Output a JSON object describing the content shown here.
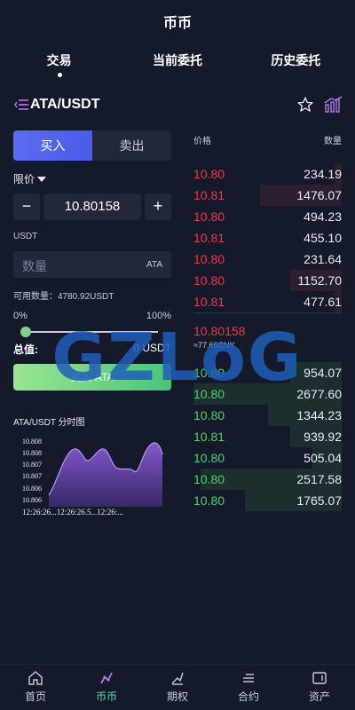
{
  "header": {
    "title": "币币"
  },
  "tabs": [
    {
      "label": "交易",
      "active": true
    },
    {
      "label": "当前委托",
      "active": false
    },
    {
      "label": "历史委托",
      "active": false
    }
  ],
  "pair": {
    "name": "ATA/USDT"
  },
  "trade": {
    "buy_label": "买入",
    "sell_label": "卖出",
    "order_type": "限价",
    "price": "10.80158",
    "minus": "−",
    "plus": "+",
    "unit_label": "USDT",
    "qty_placeholder": "数量",
    "qty_unit": "ATA",
    "available": "可用数量：4780.92USDT",
    "pct_min": "0%",
    "pct_max": "100%",
    "slider_value": 0,
    "total_label": "总值:",
    "total_value": "0 USDT",
    "submit_label": "买入 ATA"
  },
  "mini_chart": {
    "title": "ATA/USDT 分时图",
    "y_ticks": [
      "10.808",
      "10.808",
      "10.807",
      "10.807",
      "10.806",
      "10.806"
    ],
    "x_ticks": "12:26:26...12:26:26.5...12:26:..."
  },
  "orderbook": {
    "price_header": "价格",
    "qty_header": "数量",
    "asks": [
      {
        "price": "10.80",
        "qty": "234.19",
        "depth": 0.05
      },
      {
        "price": "10.81",
        "qty": "1476.07",
        "depth": 0.55
      },
      {
        "price": "10.80",
        "qty": "494.23",
        "depth": 0.0
      },
      {
        "price": "10.81",
        "qty": "455.10",
        "depth": 0.0
      },
      {
        "price": "10.80",
        "qty": "231.64",
        "depth": 0.0
      },
      {
        "price": "10.80",
        "qty": "1152.70",
        "depth": 0.35
      },
      {
        "price": "10.81",
        "qty": "477.61",
        "depth": 0.05
      }
    ],
    "last_price": "10.80158",
    "cny_price": "≈77.66CNY",
    "bids": [
      {
        "price": "10.80",
        "qty": "954.07",
        "depth": 0.35
      },
      {
        "price": "10.80",
        "qty": "2677.60",
        "depth": 1.0
      },
      {
        "price": "10.80",
        "qty": "1344.23",
        "depth": 0.5
      },
      {
        "price": "10.81",
        "qty": "939.92",
        "depth": 0.35
      },
      {
        "price": "10.80",
        "qty": "505.04",
        "depth": 0.2
      },
      {
        "price": "10.80",
        "qty": "2517.58",
        "depth": 0.95
      },
      {
        "price": "10.80",
        "qty": "1765.07",
        "depth": 0.65
      }
    ]
  },
  "watermark": "GZLoG",
  "bottom_nav": [
    {
      "label": "首页",
      "icon": "home-icon",
      "active": false
    },
    {
      "label": "币币",
      "icon": "coin-trade-icon",
      "active": true
    },
    {
      "label": "期权",
      "icon": "options-icon",
      "active": false
    },
    {
      "label": "合约",
      "icon": "contract-icon",
      "active": false
    },
    {
      "label": "资产",
      "icon": "wallet-icon",
      "active": false
    }
  ],
  "colors": {
    "background": "#151a2b",
    "ask_red": "#e53b4a",
    "bid_green": "#4fd36b",
    "buy_blue": "#5a6cf2",
    "nav_active": "#5ee0b0",
    "chart_purple": "#8a5cd6"
  }
}
